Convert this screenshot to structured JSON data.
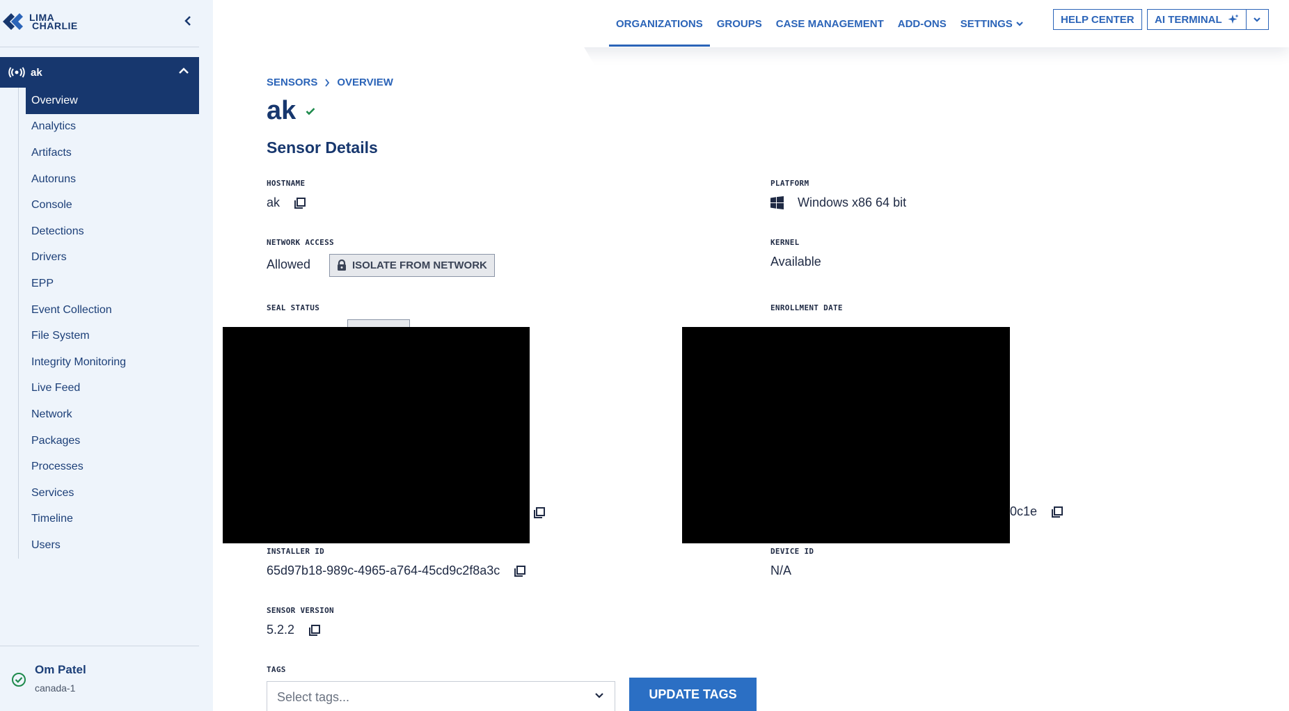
{
  "brand": {
    "line1": "LIMA",
    "line2": "CHARLIE"
  },
  "sidebar": {
    "sensor_label": "ak",
    "items": [
      {
        "label": "Overview",
        "active": true
      },
      {
        "label": "Analytics"
      },
      {
        "label": "Artifacts"
      },
      {
        "label": "Autoruns"
      },
      {
        "label": "Console"
      },
      {
        "label": "Detections"
      },
      {
        "label": "Drivers"
      },
      {
        "label": "EPP"
      },
      {
        "label": "Event Collection"
      },
      {
        "label": "File System"
      },
      {
        "label": "Integrity Monitoring"
      },
      {
        "label": "Live Feed"
      },
      {
        "label": "Network"
      },
      {
        "label": "Packages"
      },
      {
        "label": "Processes"
      },
      {
        "label": "Services"
      },
      {
        "label": "Timeline"
      },
      {
        "label": "Users"
      }
    ],
    "user": {
      "name": "Om Patel",
      "region": "canada-1"
    }
  },
  "topnav": {
    "organizations": "ORGANIZATIONS",
    "groups": "GROUPS",
    "case_management": "CASE MANAGEMENT",
    "add_ons": "ADD-ONS",
    "settings": "SETTINGS",
    "help_center": "HELP CENTER",
    "ai_terminal": "AI TERMINAL"
  },
  "breadcrumb": {
    "sensors": "SENSORS",
    "overview": "OVERVIEW"
  },
  "page": {
    "title": "ak",
    "section_title": "Sensor Details"
  },
  "details": {
    "hostname_label": "HOSTNAME",
    "hostname": "ak",
    "platform_label": "PLATFORM",
    "platform": "Windows x86 64 bit",
    "network_access_label": "NETWORK ACCESS",
    "network_access": "Allowed",
    "isolate_button": "ISOLATE FROM NETWORK",
    "kernel_label": "KERNEL",
    "kernel": "Available",
    "seal_status_label": "SEAL STATUS",
    "enrollment_label": "ENROLLMENT DATE",
    "right_partial": "0c1e",
    "installer_label": "INSTALLER ID",
    "installer_id": "65d97b18-989c-4965-a764-45cd9c2f8a3c",
    "device_label": "DEVICE ID",
    "device_id": "N/A",
    "version_label": "SENSOR VERSION",
    "version": "5.2.2",
    "tags_label": "TAGS",
    "tags_placeholder": "Select tags...",
    "update_tags_button": "UPDATE TAGS"
  },
  "colors": {
    "brand_navy": "#17376e",
    "accent_blue": "#2b64b8",
    "button_blue": "#2b6fc4",
    "sidebar_bg": "#eef4fb",
    "success_green": "#1e8a4c"
  }
}
